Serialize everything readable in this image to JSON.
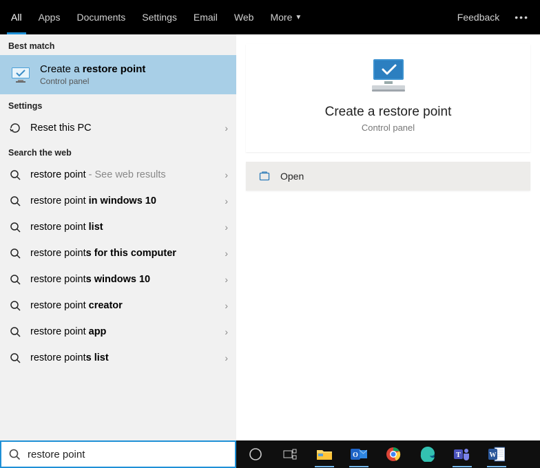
{
  "tabs": {
    "items": [
      "All",
      "Apps",
      "Documents",
      "Settings",
      "Email",
      "Web",
      "More"
    ],
    "active": "All",
    "feedback_label": "Feedback"
  },
  "sections": {
    "best_match_header": "Best match",
    "settings_header": "Settings",
    "web_header": "Search the web"
  },
  "best_match": {
    "title_prefix": "Create a ",
    "title_bold": "restore point",
    "subtitle": "Control panel"
  },
  "settings_items": [
    {
      "label": "Reset this PC",
      "icon": "reset"
    }
  ],
  "web_items": [
    {
      "prefix": "restore point",
      "bold": "",
      "suffix": " - See web results",
      "suffix_muted": true
    },
    {
      "prefix": "restore point ",
      "bold": "in windows 10",
      "suffix": ""
    },
    {
      "prefix": "restore point ",
      "bold": "list",
      "suffix": ""
    },
    {
      "prefix": "restore point",
      "bold": "s for this computer",
      "suffix": ""
    },
    {
      "prefix": "restore point",
      "bold": "s windows 10",
      "suffix": ""
    },
    {
      "prefix": "restore point ",
      "bold": "creator",
      "suffix": ""
    },
    {
      "prefix": "restore point ",
      "bold": "app",
      "suffix": ""
    },
    {
      "prefix": "restore point",
      "bold": "s list",
      "suffix": ""
    }
  ],
  "preview": {
    "title": "Create a restore point",
    "subtitle": "Control panel",
    "actions": [
      {
        "label": "Open",
        "icon": "open"
      }
    ]
  },
  "search": {
    "value": "restore point",
    "placeholder": "Type here to search"
  },
  "taskbar": {
    "items": [
      "cortana",
      "taskview",
      "explorer",
      "outlook",
      "chrome",
      "edge",
      "teams",
      "word"
    ]
  }
}
